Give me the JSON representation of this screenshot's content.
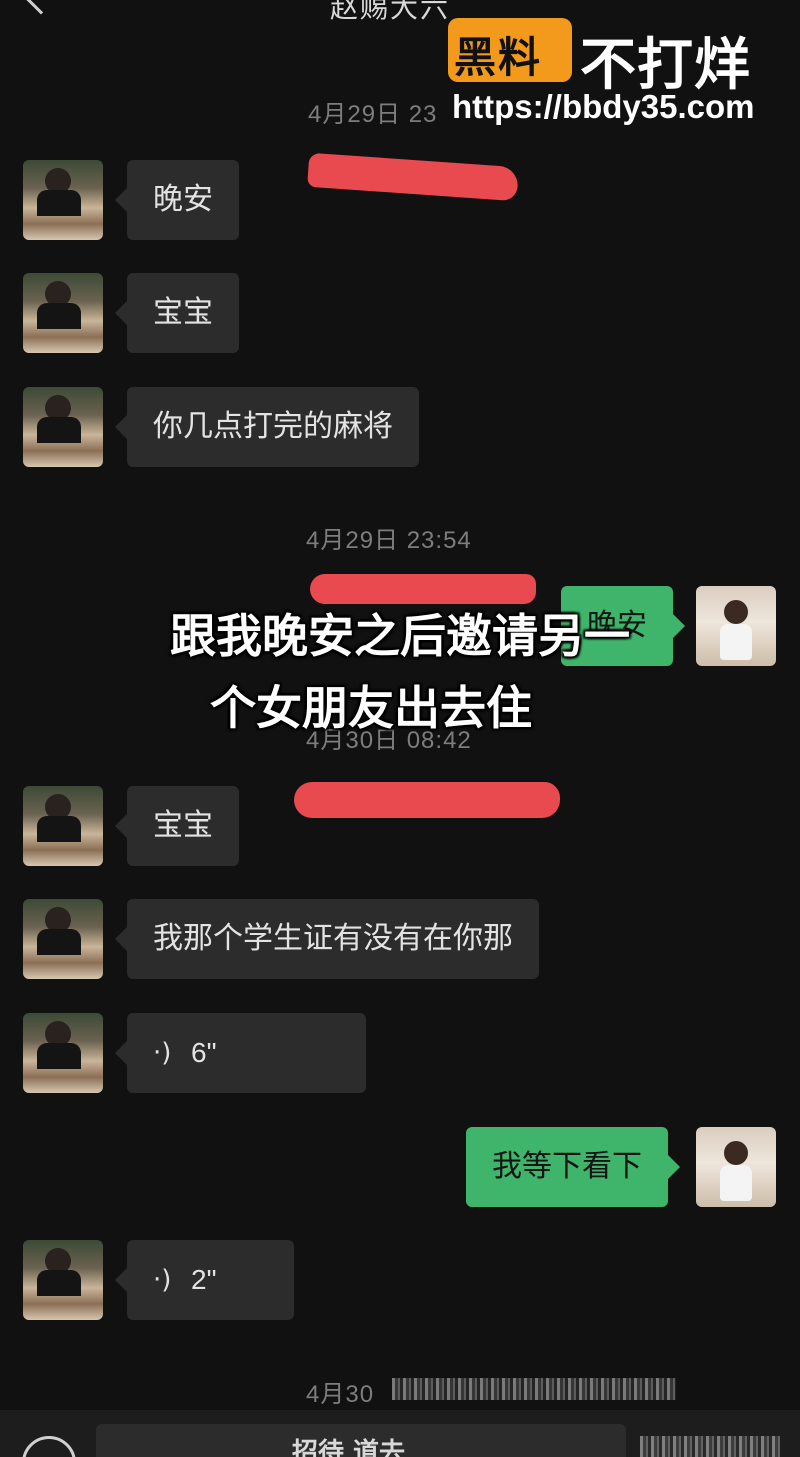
{
  "header": {
    "title": "赵赐大六"
  },
  "watermark": {
    "badge": "黑料",
    "slogan": "不打烊",
    "url": "https://bbdy35.com"
  },
  "caption": {
    "line1": "跟我晚安之后邀请另一",
    "line2": "个女朋友出去住"
  },
  "timestamps": {
    "t1": "4月29日 23",
    "t2": "4月29日 23:54",
    "t3": "4月30日 08:42",
    "t4": "4月30"
  },
  "messages": {
    "m1": "晚安",
    "m2": "宝宝",
    "m3": "你几点打完的麻将",
    "m4": "晚安",
    "m5": "宝宝",
    "m6": "我那个学生证有没有在你那",
    "m7": "6\"",
    "m8": "我等下看下",
    "m9": "2\""
  },
  "input": {
    "text": "招待 道去"
  },
  "colors": {
    "background": "#111111",
    "incoming_bubble": "#2c2c2c",
    "outgoing_bubble": "#3eb56b",
    "annotation_red": "#e84a4f",
    "watermark_orange": "#f39a1c"
  },
  "icons": {
    "back": "chevron-left-icon",
    "voice": "voice-wave-icon",
    "keyboard": "keyboard-icon"
  }
}
